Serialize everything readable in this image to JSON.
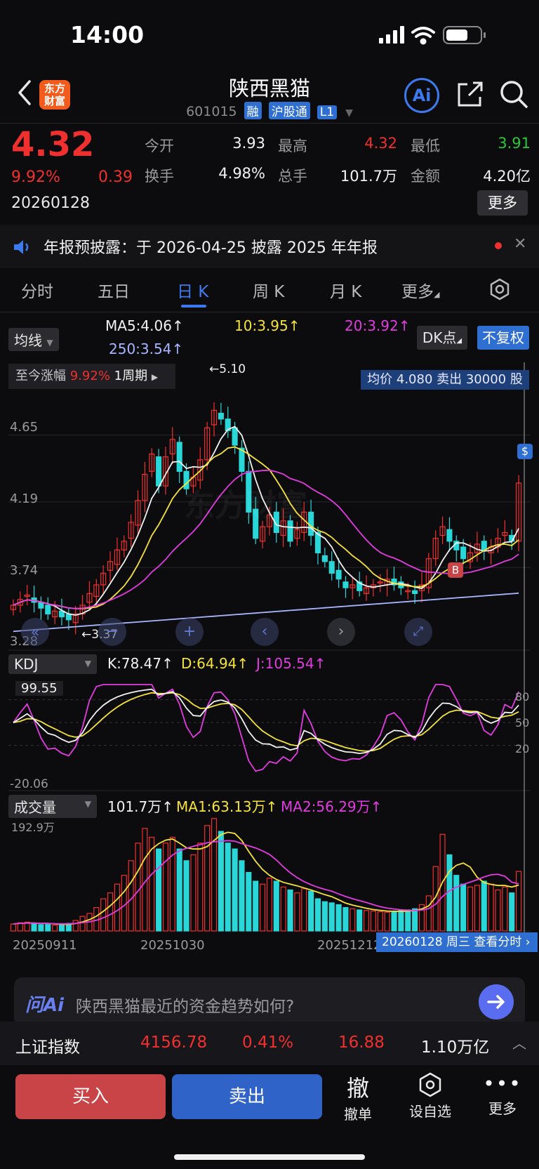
{
  "status_bar": {
    "time": "14:00"
  },
  "header": {
    "logo_text": "东方财富",
    "title": "陕西黑猫",
    "code": "601015",
    "tags": [
      "融",
      "沪股通",
      "L1"
    ],
    "ai_label": "Ai"
  },
  "quote": {
    "price": "4.32",
    "change_pct": "9.92%",
    "change_abs": "0.39",
    "date": "20260128",
    "fields": [
      {
        "label": "今开",
        "value": "3.93",
        "color": "#f2f2f2"
      },
      {
        "label": "最高",
        "value": "4.32",
        "color": "#f0302f"
      },
      {
        "label": "最低",
        "value": "3.91",
        "color": "#28c83a"
      },
      {
        "label": "换手",
        "value": "4.98%",
        "color": "#f2f2f2"
      },
      {
        "label": "总手",
        "value": "101.7万",
        "color": "#f2f2f2"
      },
      {
        "label": "金额",
        "value": "4.20亿",
        "color": "#f2f2f2"
      }
    ],
    "more_label": "更多"
  },
  "notice": {
    "text": "年报预披露：于 2026-04-25 披露 2025 年年报"
  },
  "tabs": [
    "分时",
    "五日",
    "日 K",
    "周 K",
    "月 K",
    "更多"
  ],
  "active_tab": 2,
  "ma_row": {
    "selector": "均线",
    "ma5": "MA5:4.06",
    "ma10": "10:3.95",
    "ma20": "20:3.92",
    "ma250": "250:3.54",
    "dk_label": "DK点",
    "fuquan_label": "不复权"
  },
  "kline": {
    "zhangfu_label": "至今涨幅",
    "zhangfu_value": "9.92%",
    "period_label": "1周期",
    "trade_tip": "均价 4.080 卖出 30000 股",
    "y_labels": [
      "4.65",
      "4.19",
      "3.74",
      "3.28"
    ],
    "high_mark": "5.10",
    "low_mark": "3.37",
    "watermark": "东方财富"
  },
  "kdj": {
    "selector": "KDJ",
    "k": "K:78.47",
    "d": "D:64.94",
    "j": "J:105.54",
    "top_label": "99.55",
    "bottom_label": "-20.06",
    "right_labels": [
      "80",
      "50",
      "20"
    ]
  },
  "volume": {
    "selector": "成交量",
    "current": "101.7万",
    "ma1": "MA1:63.13万",
    "ma2": "MA2:56.29万",
    "max_label": "192.9万",
    "x_labels": [
      "20250911",
      "20251030",
      "20251212"
    ],
    "date_badge": "20260128 周三  查看分时"
  },
  "ask_ai": {
    "logo": "问Ai",
    "placeholder": "陕西黑猫最近的资金趋势如何?"
  },
  "index_bar": {
    "name": "上证指数",
    "value": "4156.78",
    "pct": "0.41%",
    "change": "16.88",
    "amount": "1.10万亿"
  },
  "bottom": {
    "buy": "买入",
    "sell": "卖出",
    "cancel_icon": "撤",
    "cancel": "撤单",
    "watch": "设自选",
    "more": "更多"
  },
  "chart_data": {
    "type": "candlestick",
    "price_axis": [
      3.28,
      3.74,
      4.19,
      4.65
    ],
    "price_range": [
      3.2,
      5.15
    ],
    "closes": [
      3.48,
      3.52,
      3.55,
      3.5,
      3.46,
      3.42,
      3.44,
      3.4,
      3.38,
      3.42,
      3.48,
      3.56,
      3.62,
      3.7,
      3.78,
      3.86,
      3.92,
      4.05,
      4.2,
      4.38,
      4.52,
      4.3,
      4.5,
      4.62,
      4.4,
      4.28,
      4.36,
      4.48,
      4.7,
      4.82,
      4.76,
      4.68,
      4.58,
      4.4,
      4.12,
      3.94,
      4.02,
      4.1,
      3.98,
      4.06,
      3.92,
      4.0,
      4.12,
      3.96,
      3.84,
      3.78,
      3.7,
      3.66,
      3.6,
      3.62,
      3.58,
      3.6,
      3.62,
      3.64,
      3.66,
      3.62,
      3.6,
      3.58,
      3.56,
      3.62,
      3.8,
      3.94,
      4.02,
      3.92,
      3.86,
      3.8,
      3.84,
      3.9,
      3.86,
      3.88,
      3.94,
      3.98,
      3.92,
      4.32
    ],
    "volumes": [
      12,
      14,
      15,
      13,
      11,
      12,
      10,
      11,
      13,
      18,
      25,
      30,
      40,
      55,
      65,
      80,
      95,
      120,
      150,
      175,
      160,
      140,
      150,
      160,
      140,
      120,
      130,
      150,
      180,
      192,
      170,
      150,
      140,
      120,
      100,
      85,
      80,
      90,
      85,
      75,
      70,
      65,
      72,
      68,
      55,
      50,
      48,
      45,
      40,
      38,
      36,
      35,
      34,
      33,
      32,
      34,
      35,
      36,
      38,
      45,
      60,
      110,
      165,
      130,
      95,
      80,
      75,
      78,
      85,
      80,
      70,
      75,
      65,
      101.7
    ]
  }
}
